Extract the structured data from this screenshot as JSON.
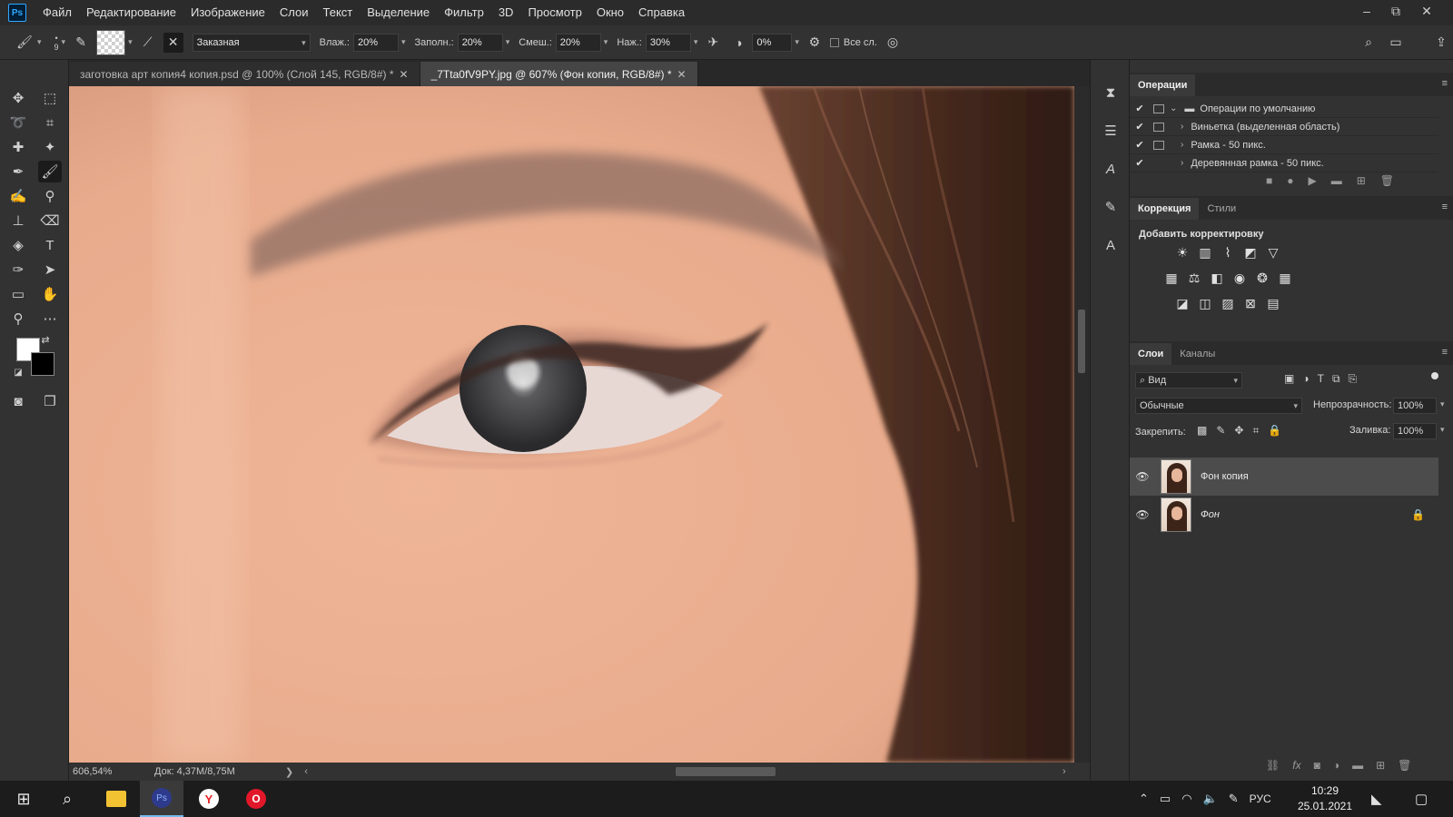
{
  "menu": {
    "logo": "Ps",
    "items": [
      "Файл",
      "Редактирование",
      "Изображение",
      "Слои",
      "Текст",
      "Выделение",
      "Фильтр",
      "3D",
      "Просмотр",
      "Окно",
      "Справка"
    ]
  },
  "window_controls": {
    "minimize": "–",
    "restore": "⧉",
    "close": "✕"
  },
  "options": {
    "brush_size": "9",
    "preset": "Заказная",
    "wet_label": "Влаж.:",
    "wet_value": "20%",
    "load_label": "Заполн.:",
    "load_value": "20%",
    "mix_label": "Смеш.:",
    "mix_value": "20%",
    "flow_label": "Наж.:",
    "flow_value": "30%",
    "angle_value": "0%",
    "all_layers_label": "Все сл."
  },
  "tabs": [
    {
      "label": "заготовка арт копия4 копия.psd @ 100% (Слой 145, RGB/8#) *",
      "close": "✕"
    },
    {
      "label": "_7Tta0fV9PY.jpg @ 607% (Фон копия, RGB/8#) *",
      "close": "✕"
    }
  ],
  "status": {
    "zoom": "606,54%",
    "doc": "Док: 4,37M/8,75M",
    "arrow": "❯",
    "left_arrow": "‹",
    "right_arrow": "›"
  },
  "actions_panel": {
    "tab": "Операции",
    "rows": [
      {
        "label": "Операции по умолчанию",
        "is_set": true
      },
      {
        "label": "Виньетка (выделенная область)",
        "is_set": false
      },
      {
        "label": "Рамка - 50 пикс.",
        "is_set": false
      },
      {
        "label": "Деревянная рамка - 50 пикс.",
        "is_set": false
      }
    ]
  },
  "adjustments_panel": {
    "tabs": [
      "Коррекция",
      "Стили"
    ],
    "heading": "Добавить корректировку"
  },
  "layers_panel": {
    "tabs": [
      "Слои",
      "Каналы"
    ],
    "filter_label": "Вид",
    "blend_mode": "Обычные",
    "opacity_label": "Непрозрачность:",
    "opacity_value": "100%",
    "lock_label": "Закрепить:",
    "fill_label": "Заливка:",
    "fill_value": "100%",
    "layers": [
      {
        "name": "Фон копия",
        "selected": true,
        "locked": false
      },
      {
        "name": "Фон",
        "selected": false,
        "locked": true
      }
    ]
  },
  "taskbar": {
    "language": "РУС",
    "time": "10:29",
    "date": "25.01.2021",
    "ps_label": "Ps"
  }
}
